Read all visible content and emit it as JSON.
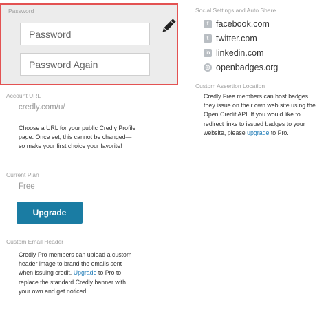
{
  "password": {
    "section_label": "Password",
    "field1_placeholder": "Password",
    "field2_placeholder": "Password Again",
    "edit_icon": "pencil-icon"
  },
  "account_url": {
    "label": "Account URL",
    "value": "credly.com/u/",
    "help_lines": [
      "Choose a URL for your public Credly Profile",
      "page. Once set, this cannot be changed—",
      "so make your first choice your favorite!"
    ]
  },
  "current_plan": {
    "label": "Current Plan",
    "value": "Free",
    "upgrade_button": "Upgrade",
    "button_color": "#1a7ca3"
  },
  "custom_email_header": {
    "label": "Custom Email Header",
    "line1": "Credly Pro members can upload a custom",
    "line2": "header image to brand the emails sent",
    "line3_pre": "when issuing credit.",
    "line3_link": "Upgrade",
    "line3_post": "to Pro to",
    "line4": "replace the standard Credly banner with",
    "line5": "your own and get noticed!"
  },
  "social": {
    "label": "Social Settings and Auto Share",
    "items": [
      {
        "icon": "facebook-icon",
        "glyph": "f",
        "label": "facebook.com"
      },
      {
        "icon": "twitter-icon",
        "glyph": "t",
        "label": "twitter.com"
      },
      {
        "icon": "linkedin-icon",
        "glyph": "in",
        "label": "linkedin.com"
      },
      {
        "icon": "openbadges-icon",
        "glyph": "◎",
        "label": "openbadges.org"
      }
    ]
  },
  "custom_assertion": {
    "label": "Custom Assertion Location",
    "line1": "Credly Free members can host badges",
    "line2": "they issue on their own web site using the",
    "line3": "Open Credit API. If you would like to",
    "line4": "redirect links to issued badges to your",
    "line5_pre": "website, please",
    "line5_link": "upgrade",
    "line5_post": "to Pro."
  },
  "colors": {
    "highlight_border": "#e35252",
    "link": "#1e7bb7"
  }
}
